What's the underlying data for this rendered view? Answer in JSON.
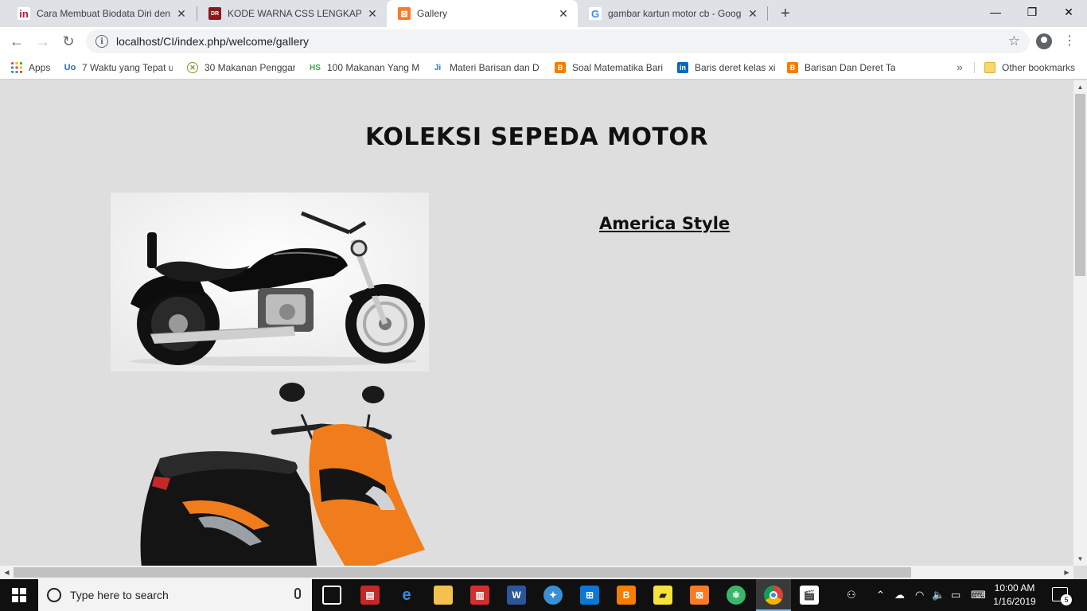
{
  "browser": {
    "tabs": [
      {
        "title": "Cara Membuat Biodata Diri deng",
        "favicon": "linkedin-slides-icon",
        "color": "#c4163f",
        "letter": "in"
      },
      {
        "title": "KODE WARNA CSS LENGKAP - Di",
        "favicon": "dianrizky-site-icon",
        "color": "#8b1a1a",
        "letter": "D"
      },
      {
        "title": "Gallery",
        "favicon": "xampp-icon",
        "color": "#fb7a24",
        "letter": "⊠"
      },
      {
        "title": "gambar kartun motor cb - Googl",
        "favicon": "google-icon",
        "color": "#4285f4",
        "letter": "G"
      }
    ],
    "new_tab_label": "+",
    "url": "localhost/CI/index.php/welcome/gallery",
    "bookmarks": [
      {
        "label": "Apps",
        "icon": "apps-grid-icon",
        "color": "#e8453c"
      },
      {
        "label": "7 Waktu yang Tepat u",
        "icon": "uo-icon",
        "color": "#2d6bd1"
      },
      {
        "label": "30 Makanan Penggar",
        "icon": "food-icon",
        "color": "#8a8a2d"
      },
      {
        "label": "100 Makanan Yang M",
        "icon": "hs-icon",
        "color": "#3aa84a"
      },
      {
        "label": "Materi Barisan dan D",
        "icon": "ji-icon",
        "color": "#1f7ac9"
      },
      {
        "label": "Soal Matematika Bari",
        "icon": "blogger-icon",
        "color": "#f57d00"
      },
      {
        "label": "Baris deret kelas xi",
        "icon": "linkedin-icon",
        "color": "#0a66c2"
      },
      {
        "label": "Barisan Dan Deret Tal",
        "icon": "blogger-icon",
        "color": "#f57d00"
      }
    ],
    "bookmarks_more": "»",
    "other_bookmarks": "Other bookmarks"
  },
  "page": {
    "title": "KOLEKSI SEPEDA MOTOR",
    "category_link": "America Style"
  },
  "taskbar": {
    "search_placeholder": "Type here to search",
    "time": "10:00 AM",
    "date": "1/16/2019",
    "notification_count": "5"
  }
}
